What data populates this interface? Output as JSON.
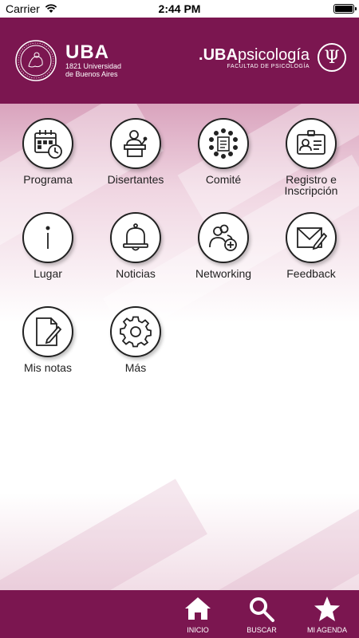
{
  "status": {
    "carrier": "Carrier",
    "time": "2:44 PM"
  },
  "header": {
    "left_brand": "UBA",
    "left_sub_1": "1821 Universidad",
    "left_sub_2": "de Buenos Aires",
    "right_brand_bold": ".UBA",
    "right_brand": "psicología",
    "right_sub": "FACULTAD DE PSICOLOGÍA",
    "psi_symbol": "Ψ"
  },
  "menu": [
    {
      "label": "Programa",
      "icon": "calendar-icon"
    },
    {
      "label": "Disertantes",
      "icon": "speaker-icon"
    },
    {
      "label": "Comité",
      "icon": "committee-icon"
    },
    {
      "label": "Registro e Inscripción",
      "icon": "id-card-icon"
    },
    {
      "label": "Lugar",
      "icon": "info-icon"
    },
    {
      "label": "Noticias",
      "icon": "bell-icon"
    },
    {
      "label": "Networking",
      "icon": "networking-icon"
    },
    {
      "label": "Feedback",
      "icon": "envelope-icon"
    },
    {
      "label": "Mis notas",
      "icon": "notes-icon"
    },
    {
      "label": "Más",
      "icon": "gear-icon"
    }
  ],
  "tabbar": [
    {
      "label": "INICIO",
      "icon": "home-icon"
    },
    {
      "label": "BUSCAR",
      "icon": "search-icon"
    },
    {
      "label": "MI AGENDA",
      "icon": "star-icon"
    }
  ],
  "colors": {
    "brand": "#7b1650"
  }
}
